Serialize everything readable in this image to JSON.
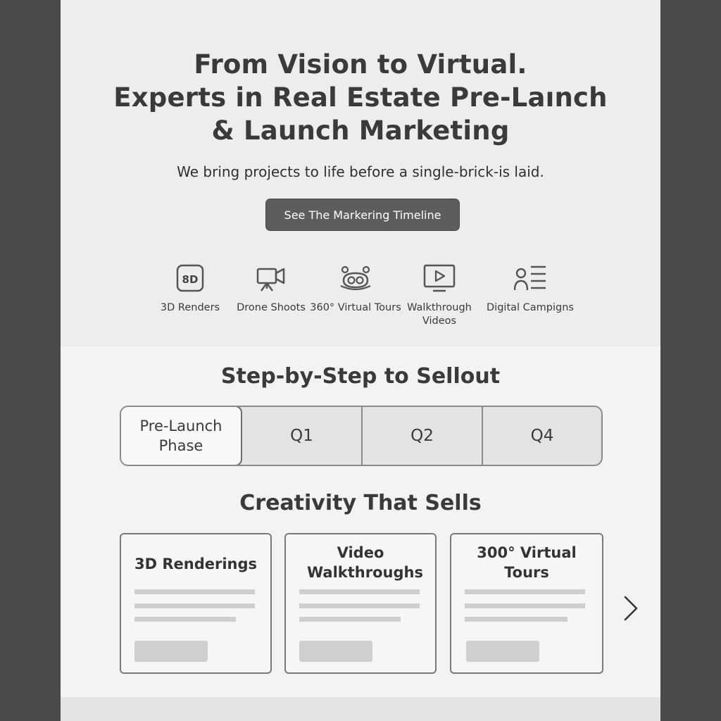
{
  "hero": {
    "title_lines": [
      "From Vision to Virtual.",
      "Experts in Real Estate Pre-Laınch",
      "& Launch Marketing"
    ],
    "subtitle": "We bring projects to life before a single-brick-is laid.",
    "cta_label": "See The Markering Timeline"
  },
  "services": [
    {
      "label": "3D Renders",
      "icon": "3d-icon",
      "badge": "8D"
    },
    {
      "label": "Drone Shoots",
      "icon": "camera-icon"
    },
    {
      "label": "360° Virtual Tours",
      "icon": "vr-headset-icon"
    },
    {
      "label": "Walkthrough Videos",
      "icon": "video-play-icon"
    },
    {
      "label": "Digital Campigns",
      "icon": "audience-list-icon"
    }
  ],
  "timeline": {
    "title": "Step-by-Step to Sellout",
    "tabs": [
      {
        "label": "Pre-Launch Phase",
        "active": true
      },
      {
        "label": "Q1",
        "active": false
      },
      {
        "label": "Q2",
        "active": false
      },
      {
        "label": "Q4",
        "active": false
      }
    ]
  },
  "creativity": {
    "title": "Creativity That Sells",
    "cards": [
      {
        "title": "3D Renderings"
      },
      {
        "title": "Video Walkthroughs"
      },
      {
        "title": "300° Virtual Tours"
      }
    ]
  },
  "colors": {
    "page_bg": "#f3f3f3",
    "outer_bg": "#4a4a4a",
    "cta_bg": "#5d5d5d",
    "tab_bg": "#e3e3e3",
    "placeholder": "#cfcfcf"
  }
}
